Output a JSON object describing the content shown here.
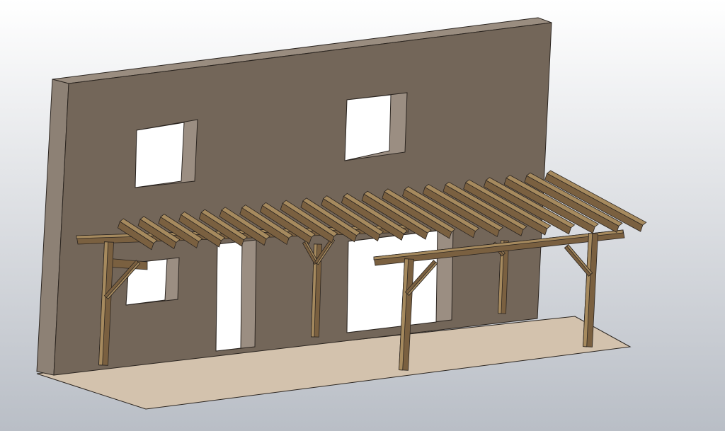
{
  "scene": {
    "subject": "pergola-attached-to-wall",
    "colors": {
      "background_top": "#ffffff",
      "background_bottom": "#b9bec6",
      "wall_face": "#736659",
      "wall_top": "#9a8d80",
      "wall_side": "#8d8175",
      "wall_reveal": "#9b8e82",
      "floor": "#d3c2ad",
      "wood": "#7a6040",
      "wood_light": "#a68a5e",
      "wood_dark": "#4f3c25",
      "opening": "#ffffff",
      "outline": "#2b2520"
    }
  }
}
